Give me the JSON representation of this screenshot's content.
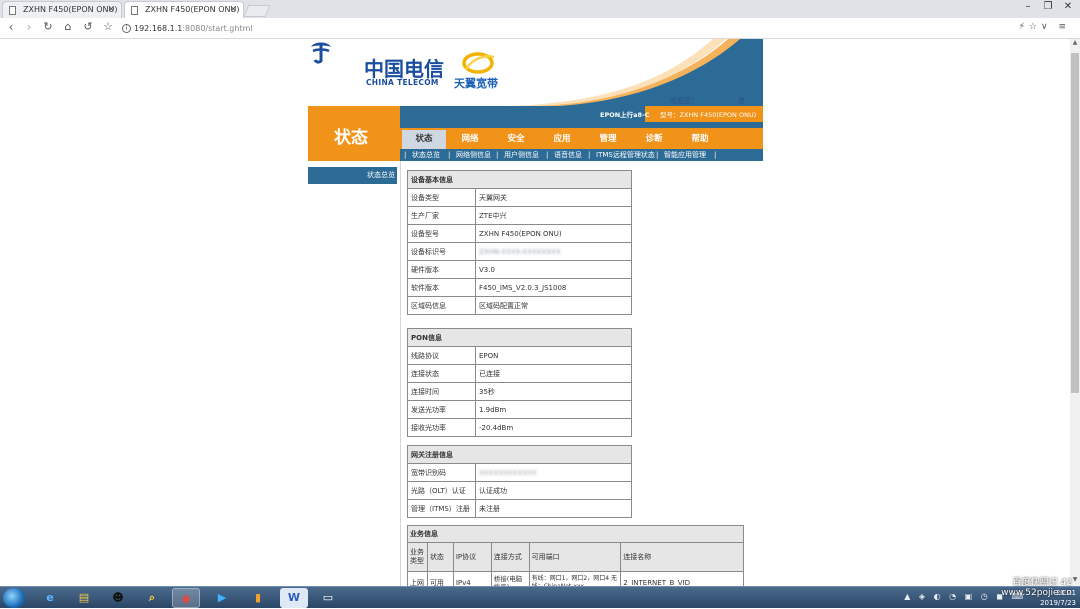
{
  "browser": {
    "tabs": [
      {
        "title": "ZXHN F450(EPON ONU)",
        "active": false
      },
      {
        "title": "ZXHN F450(EPON ONU)",
        "active": true
      }
    ],
    "url_host": "192.168.1.1",
    "url_path": ":8080/start.ghtml",
    "window_controls": [
      "minimize",
      "restore",
      "close"
    ]
  },
  "header": {
    "brand_cn": "中国电信",
    "brand_en": "CHINA TELECOM",
    "broadband_cn": "天翼宽带",
    "welcome": "欢迎您！",
    "logout": "退出",
    "epon_status": "EPON上行a8-C",
    "model": "型号：ZXHN F450(EPON ONU)"
  },
  "section_title": "状态",
  "main_nav": [
    {
      "label": "状态",
      "active": true
    },
    {
      "label": "网络",
      "active": false
    },
    {
      "label": "安全",
      "active": false
    },
    {
      "label": "应用",
      "active": false
    },
    {
      "label": "管理",
      "active": false
    },
    {
      "label": "诊断",
      "active": false
    },
    {
      "label": "帮助",
      "active": false
    }
  ],
  "sub_nav": [
    "状态总览",
    "网络侧信息",
    "用户侧信息",
    "语音信息",
    "ITMS远程管理状态",
    "智能应用管理"
  ],
  "sidebar": {
    "items": [
      "状态总览"
    ]
  },
  "device_info": {
    "title": "设备基本信息",
    "rows": [
      {
        "label": "设备类型",
        "value": "天翼网关"
      },
      {
        "label": "生产厂家",
        "value": "ZTE中兴"
      },
      {
        "label": "设备型号",
        "value": "ZXHN  F450(EPON  ONU)"
      },
      {
        "label": "设备标识号",
        "value": "ZXHN-XXXX-XXXXXXXX"
      },
      {
        "label": "硬件版本",
        "value": "V3.0"
      },
      {
        "label": "软件版本",
        "value": "F450_IMS_V2.0.3_JS1008"
      },
      {
        "label": "区域码信息",
        "value": "区域码配置正常"
      }
    ]
  },
  "pon_info": {
    "title": "PON信息",
    "rows": [
      {
        "label": "线路协议",
        "value": "EPON"
      },
      {
        "label": "连接状态",
        "value": "已连接"
      },
      {
        "label": "连接时间",
        "value": "35秒"
      },
      {
        "label": "发送光功率",
        "value": "1.9dBm"
      },
      {
        "label": "接收光功率",
        "value": "-20.4dBm"
      }
    ]
  },
  "gateway_reg": {
    "title": "网关注册信息",
    "rows": [
      {
        "label": "宽带识别码",
        "value": "XXXXXXXXXXXX"
      },
      {
        "label": "光路（OLT）认证",
        "value": "认证成功"
      },
      {
        "label": "管理（ITMS）注册",
        "value": "未注册"
      }
    ]
  },
  "service_info": {
    "title": "业务信息",
    "headers": [
      "业务类型",
      "状态",
      "IP协议",
      "连接方式",
      "可用端口",
      "连接名称"
    ],
    "row": [
      "上网",
      "可用",
      "IPv4",
      "桥接(电脑拨号)",
      "有线：网口1，网口2，网口4 无线：ChinaNet-xxx",
      "2_INTERNET_B_VID_"
    ]
  },
  "taskbar": {
    "apps": [
      "ie-icon",
      "explorer-icon",
      "qq-icon",
      "search-icon",
      "chrome-icon",
      "media-icon",
      "app-icon",
      "word-icon",
      "window-icon"
    ],
    "time": "20:21",
    "date": "2019/7/23"
  },
  "watermark": {
    "line1": "百度快照记 42",
    "line2": "www.52pojie.cn"
  }
}
